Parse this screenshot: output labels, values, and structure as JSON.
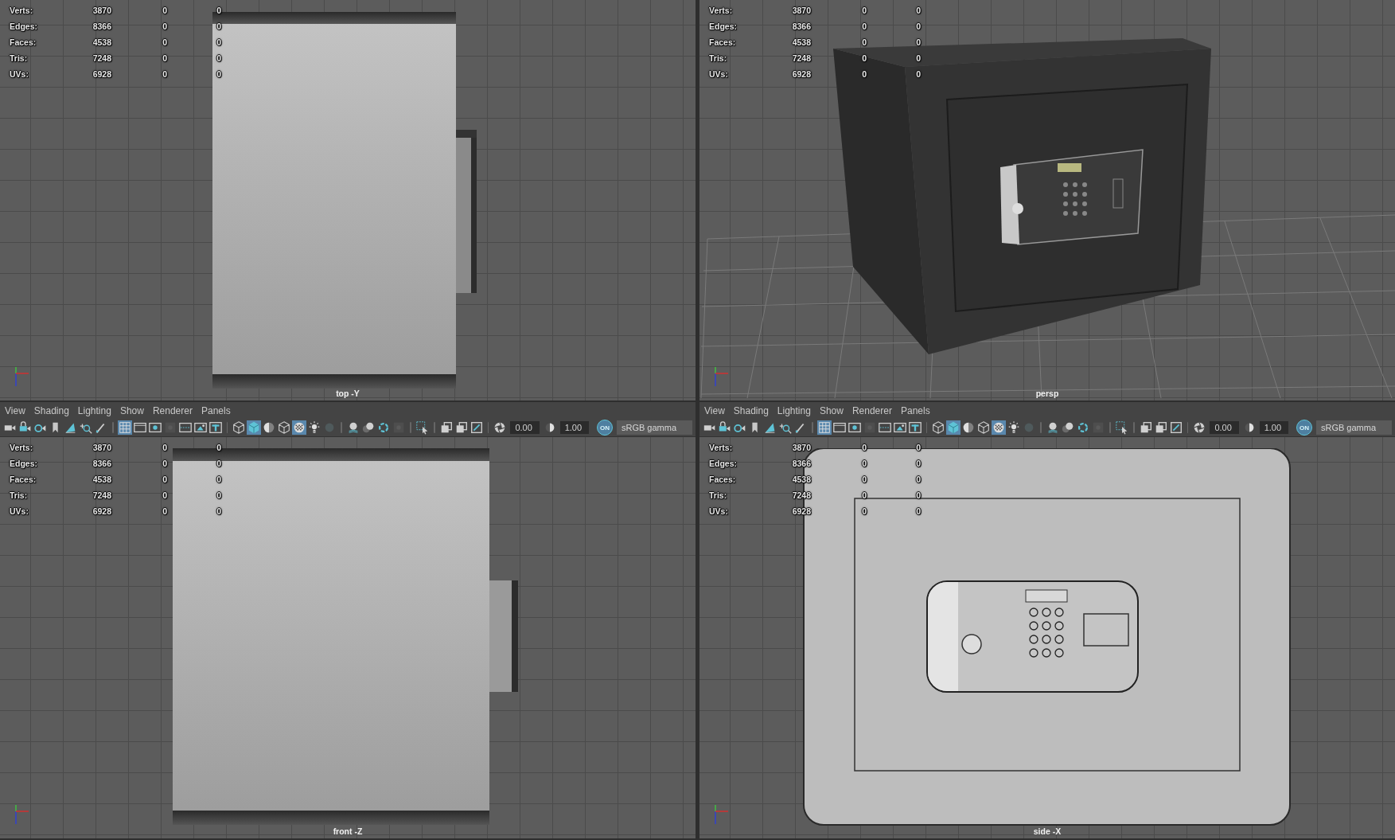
{
  "viewports": [
    {
      "camera": "top -Y",
      "kind": "side",
      "stats": [
        {
          "label": "Verts:",
          "values": [
            "3870",
            "0",
            "0"
          ]
        },
        {
          "label": "Edges:",
          "values": [
            "8366",
            "0",
            "0"
          ]
        },
        {
          "label": "Faces:",
          "values": [
            "4538",
            "0",
            "0"
          ]
        },
        {
          "label": "Tris:",
          "values": [
            "7248",
            "0",
            "0"
          ]
        },
        {
          "label": "UVs:",
          "values": [
            "6928",
            "0",
            "0"
          ]
        }
      ]
    },
    {
      "camera": "persp",
      "kind": "perspective",
      "stats": [
        {
          "label": "Verts:",
          "values": [
            "3870",
            "0",
            "0"
          ]
        },
        {
          "label": "Edges:",
          "values": [
            "8366",
            "0",
            "0"
          ]
        },
        {
          "label": "Faces:",
          "values": [
            "4538",
            "0",
            "0"
          ]
        },
        {
          "label": "Tris:",
          "values": [
            "7248",
            "0",
            "0"
          ]
        },
        {
          "label": "UVs:",
          "values": [
            "6928",
            "0",
            "0"
          ]
        }
      ]
    },
    {
      "camera": "front -Z",
      "kind": "side",
      "menu": [
        "View",
        "Shading",
        "Lighting",
        "Show",
        "Renderer",
        "Panels"
      ],
      "toolbar": [
        {
          "kind": "icon",
          "selected": false
        },
        {
          "kind": "icon",
          "selected": false
        },
        {
          "kind": "icon",
          "selected": false
        },
        {
          "kind": "icon",
          "selected": false
        },
        {
          "kind": "icon",
          "selected": false
        },
        {
          "kind": "icon",
          "selected": false
        },
        {
          "kind": "icon",
          "selected": false
        },
        {
          "kind": "separator"
        },
        {
          "kind": "icon",
          "selected": true
        },
        {
          "kind": "icon",
          "selected": false
        },
        {
          "kind": "icon",
          "selected": false
        },
        {
          "kind": "icon",
          "selected": false
        },
        {
          "kind": "icon",
          "selected": false
        },
        {
          "kind": "icon",
          "selected": false
        },
        {
          "kind": "icon",
          "selected": false
        },
        {
          "kind": "separator"
        },
        {
          "kind": "icon",
          "selected": false
        },
        {
          "kind": "icon",
          "selected": true
        },
        {
          "kind": "icon",
          "selected": false
        },
        {
          "kind": "icon",
          "selected": false
        },
        {
          "kind": "icon",
          "selected": true
        },
        {
          "kind": "icon",
          "selected": false
        },
        {
          "kind": "icon",
          "selected": false
        },
        {
          "kind": "separator"
        },
        {
          "kind": "icon",
          "selected": false
        },
        {
          "kind": "icon",
          "selected": false
        },
        {
          "kind": "icon",
          "selected": false
        },
        {
          "kind": "icon",
          "selected": false
        },
        {
          "kind": "separator"
        },
        {
          "kind": "icon",
          "selected": false
        },
        {
          "kind": "separator"
        },
        {
          "kind": "icon",
          "selected": false
        },
        {
          "kind": "icon",
          "selected": false
        },
        {
          "kind": "icon",
          "selected": false
        },
        {
          "kind": "separator"
        },
        {
          "kind": "icon",
          "selected": false
        },
        {
          "kind": "field",
          "value": "0.00"
        },
        {
          "kind": "icon",
          "selected": false
        },
        {
          "kind": "field",
          "value": "1.00"
        },
        {
          "kind": "toggle",
          "label": "ON",
          "on": true
        },
        {
          "kind": "dropdown",
          "value": "sRGB gamma"
        }
      ],
      "stats": [
        {
          "label": "Verts:",
          "values": [
            "3870",
            "0",
            "0"
          ]
        },
        {
          "label": "Edges:",
          "values": [
            "8366",
            "0",
            "0"
          ]
        },
        {
          "label": "Faces:",
          "values": [
            "4538",
            "0",
            "0"
          ]
        },
        {
          "label": "Tris:",
          "values": [
            "7248",
            "0",
            "0"
          ]
        },
        {
          "label": "UVs:",
          "values": [
            "6928",
            "0",
            "0"
          ]
        }
      ]
    },
    {
      "camera": "side -X",
      "kind": "front",
      "menu": [
        "View",
        "Shading",
        "Lighting",
        "Show",
        "Renderer",
        "Panels"
      ],
      "toolbar": [
        {
          "kind": "icon",
          "selected": false
        },
        {
          "kind": "icon",
          "selected": false
        },
        {
          "kind": "icon",
          "selected": false
        },
        {
          "kind": "icon",
          "selected": false
        },
        {
          "kind": "icon",
          "selected": false
        },
        {
          "kind": "icon",
          "selected": false
        },
        {
          "kind": "icon",
          "selected": false
        },
        {
          "kind": "separator"
        },
        {
          "kind": "icon",
          "selected": true
        },
        {
          "kind": "icon",
          "selected": false
        },
        {
          "kind": "icon",
          "selected": false
        },
        {
          "kind": "icon",
          "selected": false
        },
        {
          "kind": "icon",
          "selected": false
        },
        {
          "kind": "icon",
          "selected": false
        },
        {
          "kind": "icon",
          "selected": false
        },
        {
          "kind": "separator"
        },
        {
          "kind": "icon",
          "selected": false
        },
        {
          "kind": "icon",
          "selected": true
        },
        {
          "kind": "icon",
          "selected": false
        },
        {
          "kind": "icon",
          "selected": false
        },
        {
          "kind": "icon",
          "selected": true
        },
        {
          "kind": "icon",
          "selected": false
        },
        {
          "kind": "icon",
          "selected": false
        },
        {
          "kind": "separator"
        },
        {
          "kind": "icon",
          "selected": false
        },
        {
          "kind": "icon",
          "selected": false
        },
        {
          "kind": "icon",
          "selected": false
        },
        {
          "kind": "icon",
          "selected": false
        },
        {
          "kind": "separator"
        },
        {
          "kind": "icon",
          "selected": false
        },
        {
          "kind": "separator"
        },
        {
          "kind": "icon",
          "selected": false
        },
        {
          "kind": "icon",
          "selected": false
        },
        {
          "kind": "icon",
          "selected": false
        },
        {
          "kind": "separator"
        },
        {
          "kind": "icon",
          "selected": false
        },
        {
          "kind": "field",
          "value": "0.00"
        },
        {
          "kind": "icon",
          "selected": false
        },
        {
          "kind": "field",
          "value": "1.00"
        },
        {
          "kind": "toggle",
          "label": "ON",
          "on": true
        },
        {
          "kind": "dropdown",
          "value": "sRGB gamma"
        }
      ],
      "stats": [
        {
          "label": "Verts:",
          "values": [
            "3870",
            "0",
            "0"
          ]
        },
        {
          "label": "Edges:",
          "values": [
            "8366",
            "0",
            "0"
          ]
        },
        {
          "label": "Faces:",
          "values": [
            "4538",
            "0",
            "0"
          ]
        },
        {
          "label": "Tris:",
          "values": [
            "7248",
            "0",
            "0"
          ]
        },
        {
          "label": "UVs:",
          "values": [
            "6928",
            "0",
            "0"
          ]
        }
      ]
    }
  ]
}
